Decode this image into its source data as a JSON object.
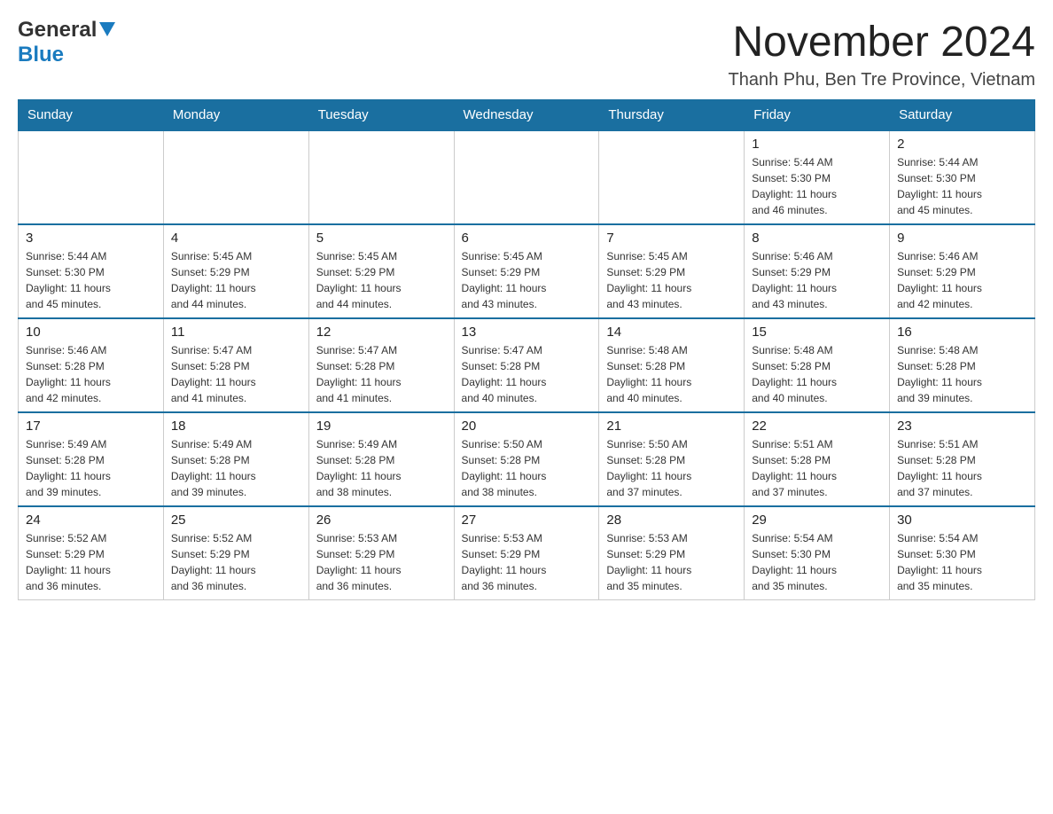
{
  "header": {
    "logo_general": "General",
    "logo_blue": "Blue",
    "month_title": "November 2024",
    "location": "Thanh Phu, Ben Tre Province, Vietnam"
  },
  "days_of_week": [
    "Sunday",
    "Monday",
    "Tuesday",
    "Wednesday",
    "Thursday",
    "Friday",
    "Saturday"
  ],
  "weeks": [
    [
      {
        "day": "",
        "info": ""
      },
      {
        "day": "",
        "info": ""
      },
      {
        "day": "",
        "info": ""
      },
      {
        "day": "",
        "info": ""
      },
      {
        "day": "",
        "info": ""
      },
      {
        "day": "1",
        "info": "Sunrise: 5:44 AM\nSunset: 5:30 PM\nDaylight: 11 hours\nand 46 minutes."
      },
      {
        "day": "2",
        "info": "Sunrise: 5:44 AM\nSunset: 5:30 PM\nDaylight: 11 hours\nand 45 minutes."
      }
    ],
    [
      {
        "day": "3",
        "info": "Sunrise: 5:44 AM\nSunset: 5:30 PM\nDaylight: 11 hours\nand 45 minutes."
      },
      {
        "day": "4",
        "info": "Sunrise: 5:45 AM\nSunset: 5:29 PM\nDaylight: 11 hours\nand 44 minutes."
      },
      {
        "day": "5",
        "info": "Sunrise: 5:45 AM\nSunset: 5:29 PM\nDaylight: 11 hours\nand 44 minutes."
      },
      {
        "day": "6",
        "info": "Sunrise: 5:45 AM\nSunset: 5:29 PM\nDaylight: 11 hours\nand 43 minutes."
      },
      {
        "day": "7",
        "info": "Sunrise: 5:45 AM\nSunset: 5:29 PM\nDaylight: 11 hours\nand 43 minutes."
      },
      {
        "day": "8",
        "info": "Sunrise: 5:46 AM\nSunset: 5:29 PM\nDaylight: 11 hours\nand 43 minutes."
      },
      {
        "day": "9",
        "info": "Sunrise: 5:46 AM\nSunset: 5:29 PM\nDaylight: 11 hours\nand 42 minutes."
      }
    ],
    [
      {
        "day": "10",
        "info": "Sunrise: 5:46 AM\nSunset: 5:28 PM\nDaylight: 11 hours\nand 42 minutes."
      },
      {
        "day": "11",
        "info": "Sunrise: 5:47 AM\nSunset: 5:28 PM\nDaylight: 11 hours\nand 41 minutes."
      },
      {
        "day": "12",
        "info": "Sunrise: 5:47 AM\nSunset: 5:28 PM\nDaylight: 11 hours\nand 41 minutes."
      },
      {
        "day": "13",
        "info": "Sunrise: 5:47 AM\nSunset: 5:28 PM\nDaylight: 11 hours\nand 40 minutes."
      },
      {
        "day": "14",
        "info": "Sunrise: 5:48 AM\nSunset: 5:28 PM\nDaylight: 11 hours\nand 40 minutes."
      },
      {
        "day": "15",
        "info": "Sunrise: 5:48 AM\nSunset: 5:28 PM\nDaylight: 11 hours\nand 40 minutes."
      },
      {
        "day": "16",
        "info": "Sunrise: 5:48 AM\nSunset: 5:28 PM\nDaylight: 11 hours\nand 39 minutes."
      }
    ],
    [
      {
        "day": "17",
        "info": "Sunrise: 5:49 AM\nSunset: 5:28 PM\nDaylight: 11 hours\nand 39 minutes."
      },
      {
        "day": "18",
        "info": "Sunrise: 5:49 AM\nSunset: 5:28 PM\nDaylight: 11 hours\nand 39 minutes."
      },
      {
        "day": "19",
        "info": "Sunrise: 5:49 AM\nSunset: 5:28 PM\nDaylight: 11 hours\nand 38 minutes."
      },
      {
        "day": "20",
        "info": "Sunrise: 5:50 AM\nSunset: 5:28 PM\nDaylight: 11 hours\nand 38 minutes."
      },
      {
        "day": "21",
        "info": "Sunrise: 5:50 AM\nSunset: 5:28 PM\nDaylight: 11 hours\nand 37 minutes."
      },
      {
        "day": "22",
        "info": "Sunrise: 5:51 AM\nSunset: 5:28 PM\nDaylight: 11 hours\nand 37 minutes."
      },
      {
        "day": "23",
        "info": "Sunrise: 5:51 AM\nSunset: 5:28 PM\nDaylight: 11 hours\nand 37 minutes."
      }
    ],
    [
      {
        "day": "24",
        "info": "Sunrise: 5:52 AM\nSunset: 5:29 PM\nDaylight: 11 hours\nand 36 minutes."
      },
      {
        "day": "25",
        "info": "Sunrise: 5:52 AM\nSunset: 5:29 PM\nDaylight: 11 hours\nand 36 minutes."
      },
      {
        "day": "26",
        "info": "Sunrise: 5:53 AM\nSunset: 5:29 PM\nDaylight: 11 hours\nand 36 minutes."
      },
      {
        "day": "27",
        "info": "Sunrise: 5:53 AM\nSunset: 5:29 PM\nDaylight: 11 hours\nand 36 minutes."
      },
      {
        "day": "28",
        "info": "Sunrise: 5:53 AM\nSunset: 5:29 PM\nDaylight: 11 hours\nand 35 minutes."
      },
      {
        "day": "29",
        "info": "Sunrise: 5:54 AM\nSunset: 5:30 PM\nDaylight: 11 hours\nand 35 minutes."
      },
      {
        "day": "30",
        "info": "Sunrise: 5:54 AM\nSunset: 5:30 PM\nDaylight: 11 hours\nand 35 minutes."
      }
    ]
  ]
}
